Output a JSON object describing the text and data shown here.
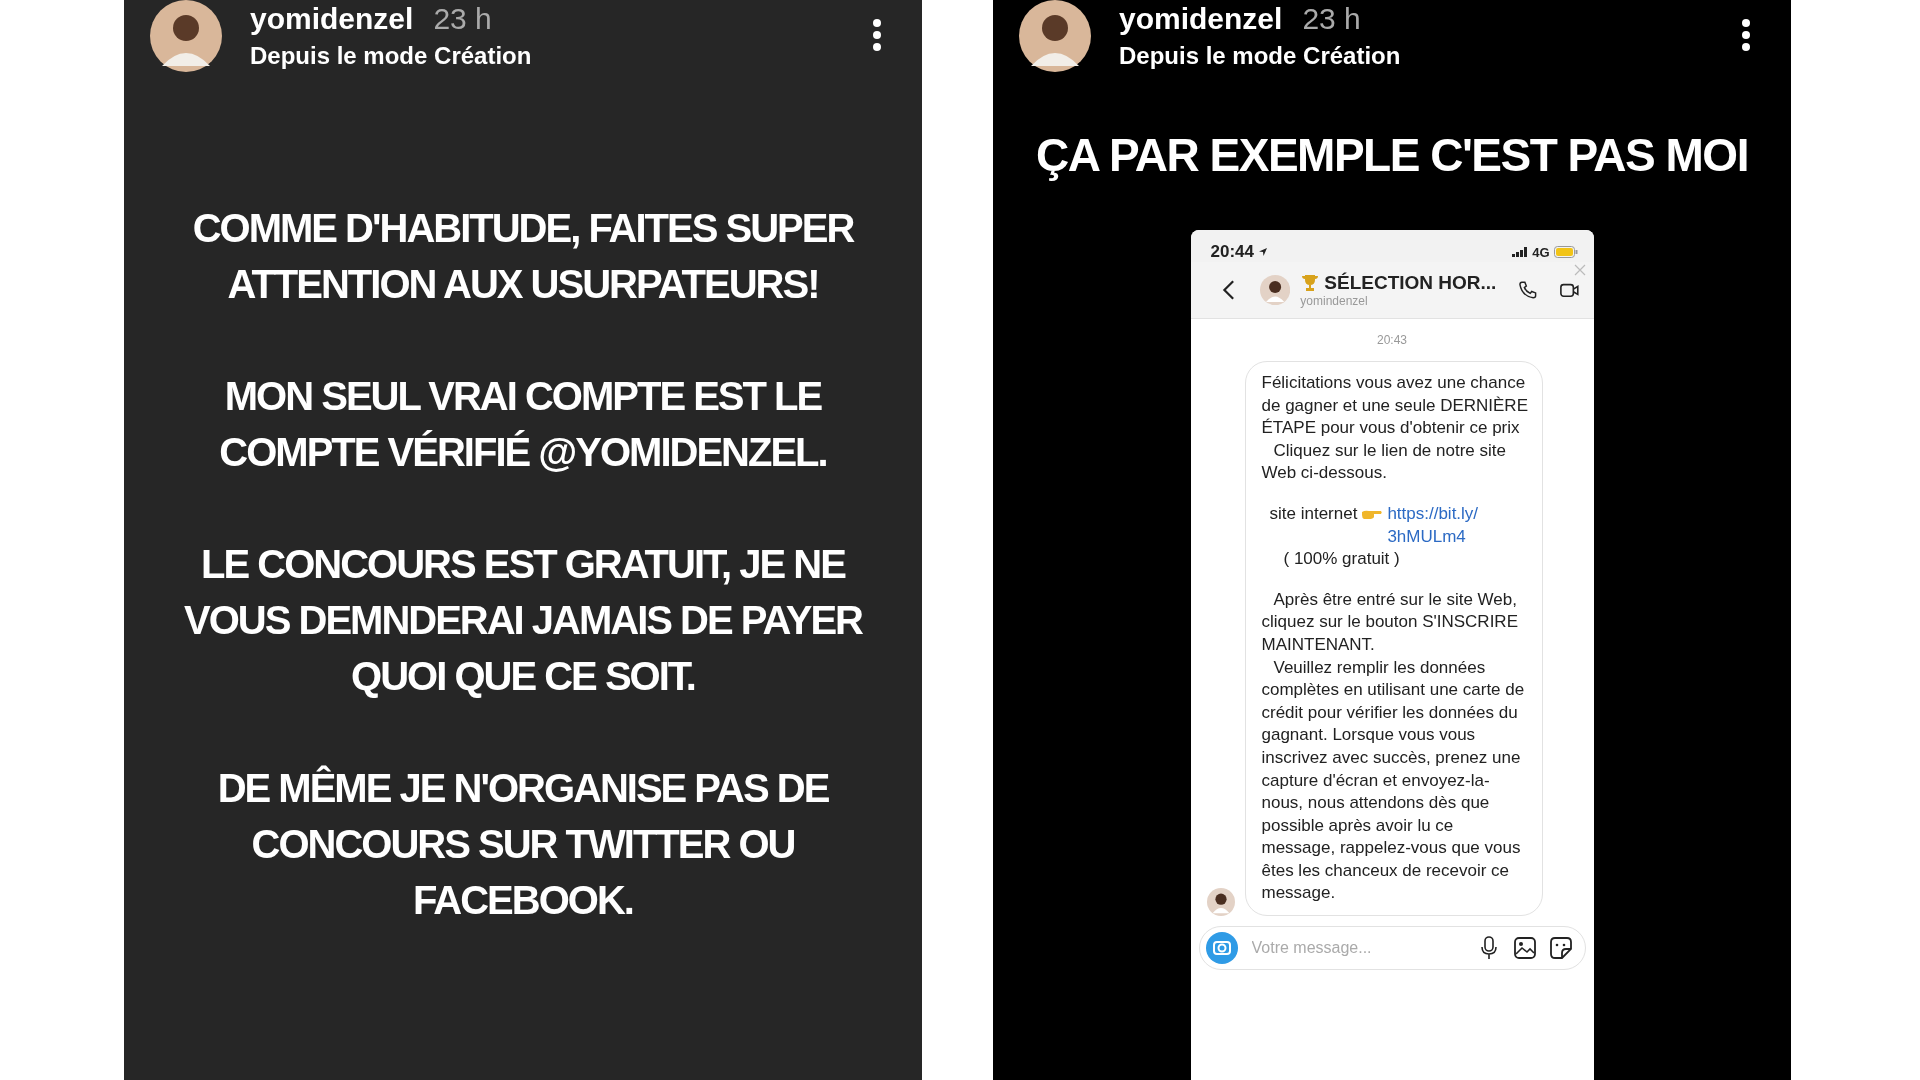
{
  "stories": [
    {
      "kind": "text",
      "username": "yomidenzel",
      "time": "23 h",
      "subtitle": "Depuis le mode Création",
      "paragraphs": [
        "COMME D'HABITUDE, FAITES SUPER ATTENTION AUX USURPATEURS!",
        "MON SEUL VRAI COMPTE EST LE COMPTE VÉRIFIÉ @YOMIDENZEL.",
        "LE CONCOURS EST GRATUIT, JE NE VOUS DEMNDERAI JAMAIS DE PAYER QUOI QUE CE SOIT.",
        "DE MÊME JE N'ORGANISE PAS DE CONCOURS SUR TWITTER OU FACEBOOK."
      ]
    },
    {
      "kind": "screenshot",
      "username": "yomidenzel",
      "time": "23 h",
      "subtitle": "Depuis le mode Création",
      "caption": "ÇA PAR EXEMPLE C'EST PAS MOI",
      "phone": {
        "clock": "20:44",
        "network": "4G",
        "chat_title": "SÉLECTION HOR...",
        "chat_handle": "yomindenzel",
        "timestamp": "20:43",
        "message": [
          {
            "kind": "text",
            "text": "Félicitations vous avez une chance de gagner et une seule DERNIÈRE ÉTAPE pour vous d'obtenir ce prix"
          },
          {
            "kind": "indented",
            "text": "Cliquez sur le lien de notre site Web ci-dessous."
          },
          {
            "kind": "link",
            "text": "site internet",
            "link": "https://bit.ly/3hMULm4"
          },
          {
            "kind": "note",
            "text": "( 100% gratuit )"
          },
          {
            "kind": "indented",
            "text": "Après être entré sur le site Web, cliquez sur le bouton S'INSCRIRE MAINTENANT."
          },
          {
            "kind": "indented",
            "text": "Veuillez remplir les données complètes en utilisant une carte de crédit pour vérifier les données du gagnant.  Lorsque vous vous inscrivez avec succès, prenez une capture d'écran et envoyez-la-nous, nous attendons dès que possible après avoir lu ce message, rappelez-vous que vous êtes les chanceux de recevoir ce message."
          }
        ],
        "composer": {
          "placeholder": "Votre message..."
        }
      }
    }
  ]
}
